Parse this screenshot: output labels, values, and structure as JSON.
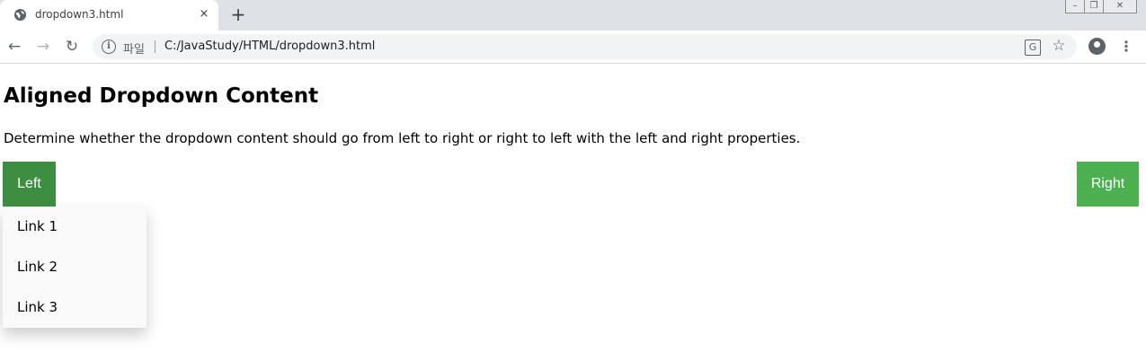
{
  "browser": {
    "tab": {
      "title": "dropdown3.html",
      "favicon": "globe-icon",
      "close": "×"
    },
    "newtab": "+",
    "window_controls": [
      "minimize-icon",
      "restore-icon",
      "close-icon"
    ],
    "toolbar": {
      "back": "←",
      "forward": "→",
      "reload": "↻",
      "scheme": "파일",
      "url": "C:/JavaStudy/HTML/dropdown3.html",
      "translate": "G",
      "star": "☆",
      "menu": "⋮"
    }
  },
  "page": {
    "heading": "Aligned Dropdown Content",
    "description": "Determine whether the dropdown content should go from left to right or right to left with the left and right properties.",
    "left_button": "Left",
    "right_button": "Right",
    "dropdown_links": [
      "Link 1",
      "Link 2",
      "Link 3"
    ]
  },
  "colors": {
    "button_green": "#4caf50",
    "button_hover_green": "#3e8e41",
    "dropdown_bg": "#f9f9f9"
  }
}
